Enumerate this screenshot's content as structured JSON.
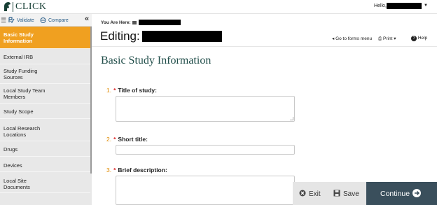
{
  "app": {
    "logo_text": "CLICK"
  },
  "header": {
    "hello_label": "Hello,"
  },
  "sidebar": {
    "tools": {
      "validate_label": "Validate",
      "compare_label": "Compare"
    },
    "items": [
      {
        "label_line1": "Basic Study",
        "label_line2": "Information",
        "active": true
      },
      {
        "label_line1": "External IRB",
        "label_line2": ""
      },
      {
        "label_line1": "Study Funding",
        "label_line2": "Sources"
      },
      {
        "label_line1": "Local Study Team",
        "label_line2": "Members"
      },
      {
        "label_line1": "Study Scope",
        "label_line2": ""
      },
      {
        "label_line1": "Local Research",
        "label_line2": "Locations"
      },
      {
        "label_line1": "Drugs",
        "label_line2": ""
      },
      {
        "label_line1": "Devices",
        "label_line2": ""
      },
      {
        "label_line1": "Local Site",
        "label_line2": "Documents"
      }
    ]
  },
  "main": {
    "you_are_here_label": "You Are Here:",
    "editing_label": "Editing:",
    "toolbar": {
      "forms_menu_label": "Go to forms menu",
      "print_label": "Print",
      "help_label": "Help"
    },
    "section_title": "Basic Study Information",
    "questions": [
      {
        "number": "1.",
        "required": "*",
        "label": "Title of study:"
      },
      {
        "number": "2.",
        "required": "*",
        "label": "Short title:"
      },
      {
        "number": "3.",
        "required": "*",
        "label": "Brief description:"
      }
    ]
  },
  "actions": {
    "exit_label": "Exit",
    "save_label": "Save",
    "continue_label": "Continue"
  },
  "colors": {
    "accent_orange": "#f0a020",
    "heading_green": "#214e4a",
    "continue_bg": "#3a4f5c",
    "required_red": "#dd2222"
  }
}
